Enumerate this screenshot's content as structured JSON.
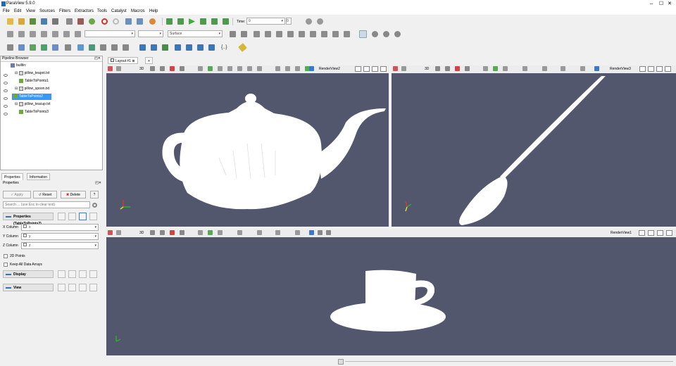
{
  "app": {
    "title": "ParaView 5.9.0"
  },
  "window_controls": [
    "–",
    "☐",
    "✕"
  ],
  "menu": [
    "File",
    "Edit",
    "View",
    "Sources",
    "Filters",
    "Extractors",
    "Tools",
    "Catalyst",
    "Macros",
    "Help"
  ],
  "toolbar": {
    "time_label": "Time:",
    "time_value": "0",
    "time_index": "0",
    "representation": "Surface"
  },
  "pipeline_browser": {
    "title": "Pipeline Browser",
    "items": [
      {
        "label": "builtin:",
        "kind": "root"
      },
      {
        "label": "pillow_teapot.txt",
        "kind": "file"
      },
      {
        "label": "TableToPoints1",
        "kind": "filter"
      },
      {
        "label": "pillow_spoon.txt",
        "kind": "file"
      },
      {
        "label": "TableToPoints2",
        "kind": "filter",
        "selected": true
      },
      {
        "label": "pillow_teacup.txt",
        "kind": "file"
      },
      {
        "label": "TableToPoints3",
        "kind": "filter"
      }
    ]
  },
  "properties_panel": {
    "tabs": [
      "Properties",
      "Information"
    ],
    "section_title": "Properties",
    "apply": "Apply",
    "reset": "Reset",
    "delete": "Delete",
    "help": "?",
    "search_placeholder": "Search ... (use Esc to clear text)",
    "group_label": "Properties (TableToPoints2)",
    "fields": [
      {
        "label": "X Column",
        "value": "x"
      },
      {
        "label": "Y Column",
        "value": "y"
      },
      {
        "label": "Z Column",
        "value": "z"
      }
    ],
    "checkboxes": [
      {
        "label": "2D Points",
        "checked": false
      },
      {
        "label": "Keep All Data Arrays",
        "checked": false
      }
    ],
    "display_section": "Display",
    "view_section": "View"
  },
  "layout_tabs": [
    {
      "label": "Layout #1"
    },
    {
      "label": "+"
    }
  ],
  "views": [
    {
      "name": "RenderView2",
      "object": "teapot"
    },
    {
      "name": "RenderView3",
      "object": "spoon"
    },
    {
      "name": "RenderView1",
      "object": "teacup"
    }
  ],
  "colors": {
    "view_bg": "#52576e",
    "selection": "#3399ff"
  }
}
